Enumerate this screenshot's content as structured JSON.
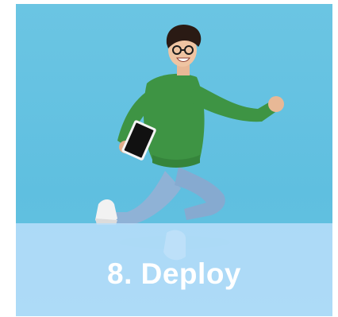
{
  "card": {
    "caption": "8. Deploy",
    "image_subject": "person-jumping-with-tablet",
    "colors": {
      "background": "#62c1e2",
      "caption_band": "#b9defa",
      "caption_text": "#ffffff",
      "sweater": "#3e9444",
      "jeans": "#8fb2d6"
    }
  }
}
